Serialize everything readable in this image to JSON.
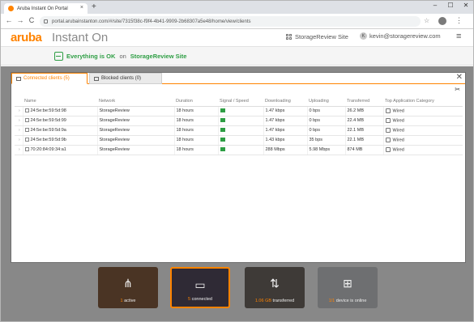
{
  "browser": {
    "tab_title": "Aruba Instant On Portal",
    "tab_close": "×",
    "new_tab": "+",
    "url": "portal.arubainstanton.com/#/site/7315f38c-f9f4-4b41-9909-2b68307a5e48/home/view/clients",
    "window_controls": [
      "–",
      "☐",
      "✕"
    ],
    "nav": [
      "←",
      "→",
      "C"
    ],
    "star": "☆",
    "menu": "⋮"
  },
  "app": {
    "logo": "aruba",
    "product": "Instant On",
    "site_link": "StorageReview Site",
    "user_initial": "K",
    "user_email": "kevin@storagereview.com",
    "menu_icon": "≡"
  },
  "status": {
    "text": "Everything is OK",
    "on": "on",
    "site": "StorageReview Site"
  },
  "modal": {
    "tabs": [
      {
        "label": "Connected clients",
        "count": "(5)"
      },
      {
        "label": "Blocked clients",
        "count": "(0)"
      }
    ],
    "close": "✕",
    "columns": [
      "",
      "Name",
      "Network",
      "Duration",
      "Signal / Speed",
      "Downloading",
      "Uploading",
      "Transferred",
      "Top Application Category"
    ],
    "rows": [
      {
        "name": "24:5e:be:59:5d:98",
        "network": "StorageReview",
        "duration": "18 hours",
        "down": "1.47 kbps",
        "up": "0 bps",
        "transferred": "26.2 MB",
        "category": "Wired"
      },
      {
        "name": "24:5e:be:59:5d:99",
        "network": "StorageReview",
        "duration": "18 hours",
        "down": "1.47 kbps",
        "up": "0 bps",
        "transferred": "22.4 MB",
        "category": "Wired"
      },
      {
        "name": "24:5e:be:59:5d:9a",
        "network": "StorageReview",
        "duration": "18 hours",
        "down": "1.47 kbps",
        "up": "0 bps",
        "transferred": "22.1 MB",
        "category": "Wired"
      },
      {
        "name": "24:5e:be:59:5d:9b",
        "network": "StorageReview",
        "duration": "18 hours",
        "down": "1.43 kbps",
        "up": "35 bps",
        "transferred": "22.1 MB",
        "category": "Wired"
      },
      {
        "name": "70:20:84:09:34:a1",
        "network": "StorageReview",
        "duration": "18 hours",
        "down": "288 Mbps",
        "up": "5.98 Mbps",
        "transferred": "874 MB",
        "category": "Wired"
      }
    ]
  },
  "tiles": [
    {
      "number": "1",
      "label": " active"
    },
    {
      "number": "5",
      "label": " connected"
    },
    {
      "number": "1.06 GB",
      "label": " transferred"
    },
    {
      "number": "1/1",
      "label": " device is online"
    }
  ],
  "colors": {
    "accent": "#ff8300",
    "ok": "#2e9e44"
  }
}
